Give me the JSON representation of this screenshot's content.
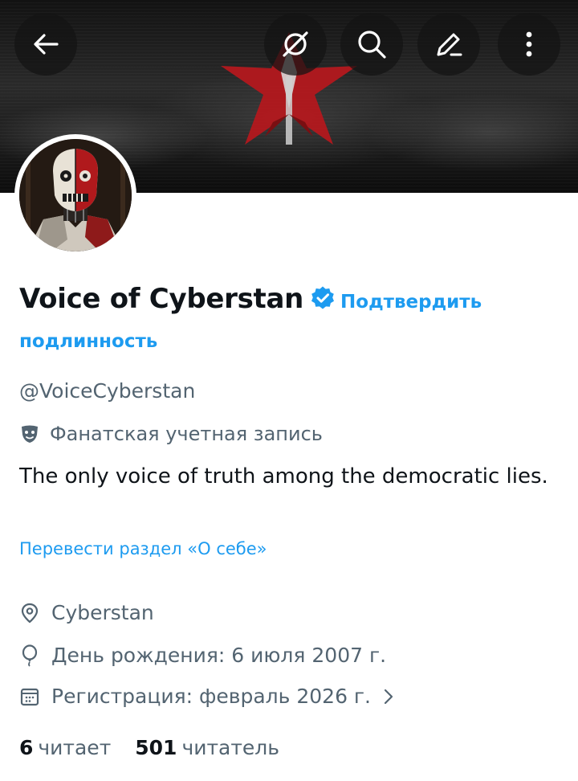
{
  "header": {
    "back_icon": "arrow-left-icon",
    "grok_icon": "grok-icon",
    "search_icon": "search-icon",
    "edit_icon": "pencil-icon",
    "more_icon": "more-vertical-icon"
  },
  "profile": {
    "display_name": "Voice of Cyberstan",
    "verify_link_line1": "Подтвердить",
    "verify_link_line2": "подлинность",
    "handle": "@VoiceCyberstan",
    "fan_account_label": "Фанатская учетная запись",
    "bio": "The only voice of truth among the democratic lies.",
    "translate_link": "Перевести раздел «О себе»",
    "location": "Cyberstan",
    "birthday": "День рождения: 6 июля 2007 г.",
    "joined": "Регистрация: февраль 2026 г."
  },
  "stats": {
    "following_count": "6",
    "following_label": "читает",
    "followers_count": "501",
    "followers_label": "читатель"
  },
  "colors": {
    "accent": "#1d9bf0",
    "text_primary": "#0f1419",
    "text_secondary": "#536471",
    "emblem_red": "#b3181d"
  }
}
